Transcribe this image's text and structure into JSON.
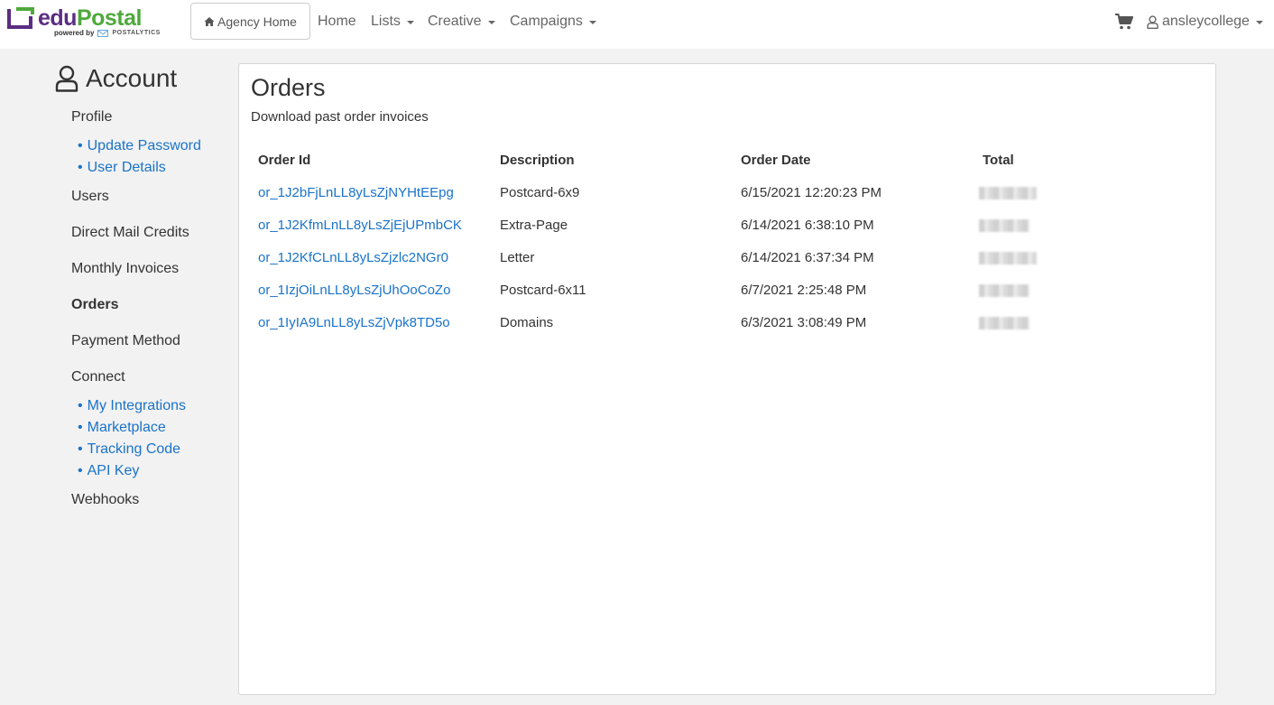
{
  "brand": {
    "name_part1": "edu",
    "name_part2": "Postal",
    "powered_by": "powered by",
    "partner": "POSTALYTICS",
    "colors": {
      "purple": "#5a2d82",
      "green": "#4ea93b"
    }
  },
  "nav": {
    "agency_home": "Agency Home",
    "home": "Home",
    "lists": "Lists",
    "creative": "Creative",
    "campaigns": "Campaigns",
    "username": "ansleycollege",
    "icons": {
      "agency": "home-icon",
      "cart": "cart-icon",
      "user": "user-icon"
    }
  },
  "sidebar": {
    "title": "Account",
    "profile": "Profile",
    "profile_sub": [
      "Update Password",
      "User Details"
    ],
    "users": "Users",
    "direct_mail_credits": "Direct Mail Credits",
    "monthly_invoices": "Monthly Invoices",
    "orders": "Orders",
    "payment_method": "Payment Method",
    "connect": "Connect",
    "connect_sub": [
      "My Integrations",
      "Marketplace",
      "Tracking Code",
      "API Key"
    ],
    "webhooks": "Webhooks",
    "bullet": "•",
    "link_color": "#1a73c9"
  },
  "main": {
    "title": "Orders",
    "subtitle": "Download past order invoices",
    "columns": [
      "Order Id",
      "Description",
      "Order Date",
      "Total"
    ],
    "rows": [
      {
        "id": "or_1J2bFjLnLL8yLsZjNYHtEEpg",
        "description": "Postcard-6x9",
        "date": "6/15/2021 12:20:23 PM",
        "total": ""
      },
      {
        "id": "or_1J2KfmLnLL8yLsZjEjUPmbCK",
        "description": "Extra-Page",
        "date": "6/14/2021 6:38:10 PM",
        "total": ""
      },
      {
        "id": "or_1J2KfCLnLL8yLsZjzlc2NGr0",
        "description": "Letter",
        "date": "6/14/2021 6:37:34 PM",
        "total": ""
      },
      {
        "id": "or_1IzjOiLnLL8yLsZjUhOoCoZo",
        "description": "Postcard-6x11",
        "date": "6/7/2021 2:25:48 PM",
        "total": ""
      },
      {
        "id": "or_1IyIA9LnLL8yLsZjVpk8TD5o",
        "description": "Domains",
        "date": "6/3/2021 3:08:49 PM",
        "total": ""
      }
    ]
  }
}
